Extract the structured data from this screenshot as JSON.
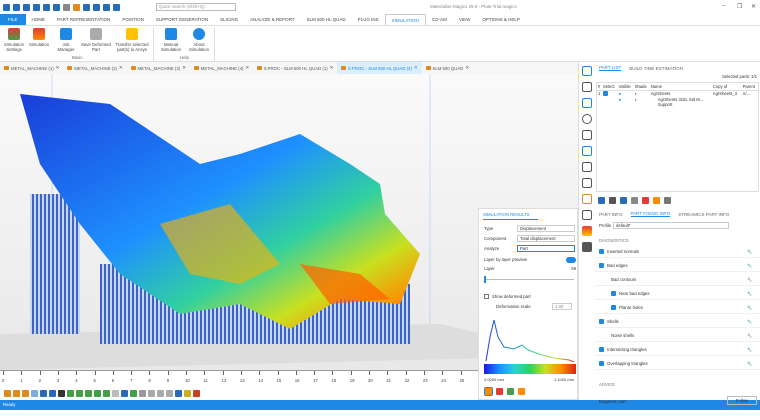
{
  "window": {
    "title": "Materialise Magics 25.0 - Plate Trial.magics",
    "quick_search_placeholder": "Quick search (Shift+Q)"
  },
  "ribbon_tabs": [
    "FILE",
    "HOME",
    "PART REPRESENTATION",
    "POSITION",
    "SUPPORT GENERATION",
    "SLICING",
    "ANALYZE & REPORT",
    "SLM 500 HL QUAD",
    "PLUG INS",
    "SIMULATION",
    "CO-AM",
    "VIEW",
    "OPTIONS & HELP"
  ],
  "active_ribbon_tab": "SIMULATION",
  "ribbon": {
    "buttons": [
      "Simulation Settings",
      "Simulation",
      "Job Manager",
      "Save Deformed Part",
      "Transfer selected part(s) to Ansys",
      "Manual Simulation",
      "About Simulation"
    ],
    "groups": {
      "basic": "Basic",
      "help": "Help"
    }
  },
  "doc_tabs": [
    "METAL_MACHINE (1)",
    "METAL_MACHINE (2)",
    "METAL_MACHINE (3)",
    "METAL_MACHINE (4)",
    "8.PROC - SLM 500 HL QUAD (1)",
    "8.PROC - SLM 500 HL QUAD (2)",
    "SLM 500 QUAD"
  ],
  "active_doc_tab": "8.PROC - SLM 500 HL QUAD (2)",
  "ruler_ticks": [
    "0",
    "1",
    "2",
    "3",
    "4",
    "5",
    "6",
    "7",
    "8",
    "9",
    "10",
    "11",
    "12",
    "13",
    "14",
    "15",
    "16",
    "17",
    "18",
    "19",
    "20",
    "21",
    "22",
    "23",
    "24",
    "25",
    "26"
  ],
  "part_list": {
    "tabs": [
      "PART LIST",
      "BUILD TIME ESTIMATION"
    ],
    "selected_parts": "Selected parts: 1/1",
    "columns": [
      "#",
      "Select",
      "Visible",
      "Shade",
      "Name",
      "Copy of",
      "Parent"
    ],
    "rows": [
      {
        "index": "1",
        "name": "AgrSheets",
        "copy_of": "AgrSheets_3",
        "parent": "A/..."
      },
      {
        "index": "",
        "name": "AgrSheets 316L Std M...",
        "copy_of": "",
        "parent": ""
      },
      {
        "index": "",
        "name": "Support",
        "copy_of": "",
        "parent": ""
      }
    ]
  },
  "info_tabs": [
    "PART INFO",
    "PART FIXING INFO",
    "STREAMICS PART INFO"
  ],
  "fixing": {
    "profile_label": "Profile",
    "profile_value": "default*",
    "diagnostics_label": "DIAGNOSTICS",
    "items": [
      {
        "label": "Inverted normals",
        "checked": true,
        "indent": 0
      },
      {
        "label": "Bad edges",
        "checked": true,
        "indent": 0
      },
      {
        "label": "Bad contours",
        "checked": null,
        "indent": 1
      },
      {
        "label": "Near bad edges",
        "checked": true,
        "indent": 1
      },
      {
        "label": "Planar holes",
        "checked": true,
        "indent": 1
      },
      {
        "label": "Shells",
        "checked": true,
        "indent": 0
      },
      {
        "label": "Noise shells",
        "checked": null,
        "indent": 1
      },
      {
        "label": "Intersecting triangles",
        "checked": true,
        "indent": 0
      },
      {
        "label": "Overlapping triangles",
        "checked": true,
        "indent": 0
      }
    ],
    "advice_label": "ADVICE",
    "advice_text": "Diagnose part.",
    "follow_button": "Follow"
  },
  "sim_results": {
    "title": "SIMULATION RESULTS",
    "type_label": "Type",
    "type_value": "Displacement",
    "component_label": "Component",
    "component_value": "Total displacement",
    "analyze_label": "Analyze",
    "analyze_value": "Part",
    "layer_preview_label": "Layer by layer preview",
    "layer_preview_on": true,
    "layer_label": "Layer",
    "layer_value": "59",
    "show_deformed_label": "Show deformed part",
    "show_deformed": false,
    "deformation_scale_label": "Deformation scale",
    "deformation_scale_value": "1.00",
    "legend_min": "0.0000 mm",
    "legend_max": "1.1000 mm"
  },
  "status": "Ready"
}
